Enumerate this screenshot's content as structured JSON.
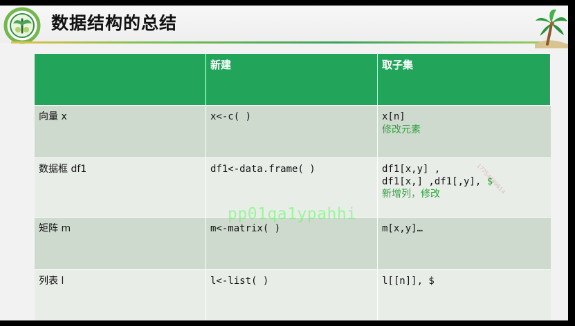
{
  "slide": {
    "title": "数据结构的总结"
  },
  "table": {
    "headers": [
      "",
      "新建",
      "取子集"
    ],
    "rows": [
      {
        "type": "向量 x",
        "create": "x<-c( )",
        "subset": [
          "x[n]"
        ],
        "subset_note": "修改元素"
      },
      {
        "type": "数据框 df1",
        "create": "df1<-data.frame( )",
        "subset": [
          "df1[x,y] ,",
          "df1[x,] ,df1[,y],"
        ],
        "subset_symbol": "$",
        "subset_note": "新增列，修改"
      },
      {
        "type": "矩阵 m",
        "create": "m<-matrix( )",
        "subset": [
          "m[x,y]…"
        ]
      },
      {
        "type": "列表 l",
        "create": "l<-list( )",
        "subset": [
          "l[[n]], $"
        ]
      }
    ]
  },
  "watermark": {
    "main": "pp01qa1ypahhi",
    "phone": "17754389614"
  },
  "colors": {
    "header_green": "#22a55a",
    "note_green": "#30a43d",
    "row_dark": "#cfdacf",
    "row_light": "#e8ede8"
  },
  "icons": [
    "logo-icon",
    "palm-tree-icon"
  ]
}
